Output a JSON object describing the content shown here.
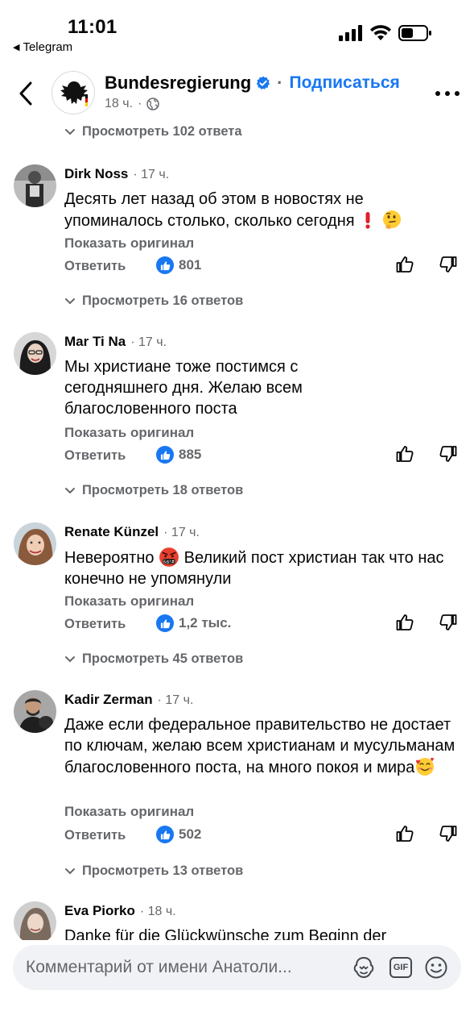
{
  "status_bar": {
    "time": "11:01",
    "back_app": "Telegram"
  },
  "header": {
    "page_name": "Bundesregierung",
    "separator": "·",
    "subscribe_label": "Подписаться",
    "meta_time": "18 ч.",
    "meta_dot": "·"
  },
  "top_replies": {
    "label": "Просмотреть 102 ответа"
  },
  "comments": [
    {
      "author": "Dirk Noss",
      "time": "· 17 ч.",
      "text": "Десять лет назад об этом в новостях не упоминалось столько, сколько сегодня",
      "emojis": [
        "exclamation-emoji",
        "thinking-face-emoji"
      ],
      "show_original": "Показать оригинал",
      "reply_label": "Ответить",
      "likes": "801",
      "replies_label": "Просмотреть 16 ответов"
    },
    {
      "author": "Mar Ti Na",
      "time": "· 17 ч.",
      "text": "Мы христиане тоже постимся с сегодняшнего дня. Желаю всем благословенного поста",
      "show_original": "Показать оригинал",
      "reply_label": "Ответить",
      "likes": "885",
      "replies_label": "Просмотреть 18 ответов"
    },
    {
      "author": "Renate Künzel",
      "time": "· 17 ч.",
      "text_before": "Невероятно",
      "text_after": "Великий пост христиан так что нас конечно не упомянули",
      "emojis": [
        "swearing-face-emoji"
      ],
      "show_original": "Показать оригинал",
      "reply_label": "Ответить",
      "likes": "1,2 тыс.",
      "replies_label": "Просмотреть 45 ответов"
    },
    {
      "author": "Kadir Zerman",
      "time": "· 17 ч.",
      "text": "Даже если федеральное правительство не достает по ключам, желаю всем христианам и мусульманам благословенного поста, на много покоя и мира",
      "emojis": [
        "smiling-face-with-hearts-emoji"
      ],
      "show_original": "Показать оригинал",
      "reply_label": "Ответить",
      "likes": "502",
      "replies_label": "Просмотреть 13 ответов"
    },
    {
      "author": "Eva Piorko",
      "time": "· 18 ч.",
      "text": "Danke für die Glückwünsche zum Beginn der"
    }
  ],
  "composer": {
    "placeholder": "Комментарий от имени Анатоли...",
    "gif_label": "GIF"
  },
  "colors": {
    "accent": "#1877f2",
    "secondary_text": "#65676b",
    "primary_text": "#050505",
    "input_bg": "#f0f2f5"
  }
}
